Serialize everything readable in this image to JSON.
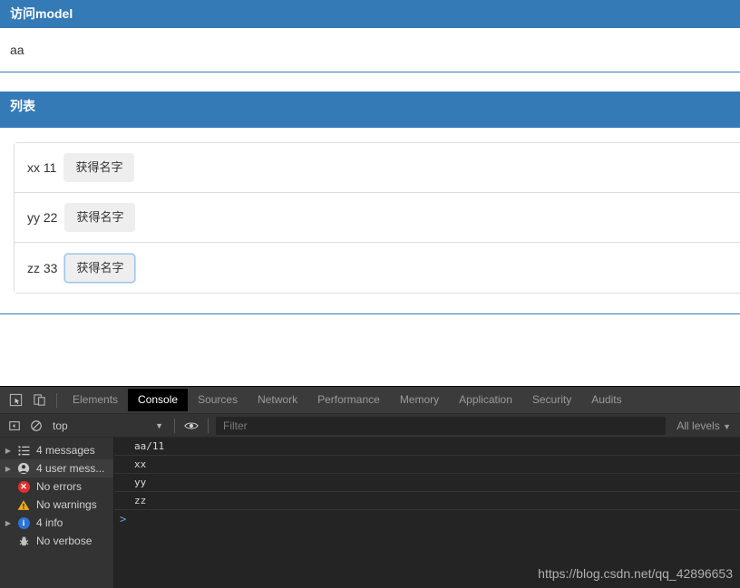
{
  "page": {
    "model_panel": {
      "title": "访问model",
      "body_text": "aa"
    },
    "list_panel": {
      "title": "列表",
      "items": [
        {
          "text": "xx 11",
          "button_label": "获得名字",
          "focused": false
        },
        {
          "text": "yy 22",
          "button_label": "获得名字",
          "focused": false
        },
        {
          "text": "zz 33",
          "button_label": "获得名字",
          "focused": true
        }
      ]
    },
    "accent_color": "#337ab7"
  },
  "devtools": {
    "tabs": [
      {
        "label": "Elements",
        "active": false
      },
      {
        "label": "Console",
        "active": true
      },
      {
        "label": "Sources",
        "active": false
      },
      {
        "label": "Network",
        "active": false
      },
      {
        "label": "Performance",
        "active": false
      },
      {
        "label": "Memory",
        "active": false
      },
      {
        "label": "Application",
        "active": false
      },
      {
        "label": "Security",
        "active": false
      },
      {
        "label": "Audits",
        "active": false
      }
    ],
    "left_icons": [
      {
        "name": "inspect-element-icon"
      },
      {
        "name": "device-toolbar-icon"
      }
    ],
    "filter_bar": {
      "sidebar_toggle_icon": "console-sidebar-icon",
      "clear_console_icon": "clear-console-icon",
      "context": "top",
      "context_caret": "▼",
      "eye_icon": "live-expression-eye-icon",
      "filter_placeholder": "Filter",
      "filter_value": "",
      "levels": "All levels",
      "levels_caret": "▼"
    },
    "sidebar": [
      {
        "label": "4 messages",
        "icon": "list-icon",
        "arrow": "▶",
        "selected": false
      },
      {
        "label": "4 user mess...",
        "icon": "user-icon",
        "arrow": "▶",
        "selected": true
      },
      {
        "label": "No errors",
        "icon": "error-icon",
        "arrow": "",
        "selected": false
      },
      {
        "label": "No warnings",
        "icon": "warning-icon",
        "arrow": "",
        "selected": false
      },
      {
        "label": "4 info",
        "icon": "info-icon",
        "arrow": "▶",
        "selected": false
      },
      {
        "label": "No verbose",
        "icon": "verbose-bug-icon",
        "arrow": "",
        "selected": false
      }
    ],
    "console_logs": [
      {
        "text": "aa/11"
      },
      {
        "text": "xx"
      },
      {
        "text": "yy"
      },
      {
        "text": "zz"
      }
    ],
    "prompt_symbol": ">",
    "watermark": "https://blog.csdn.net/qq_42896653"
  }
}
